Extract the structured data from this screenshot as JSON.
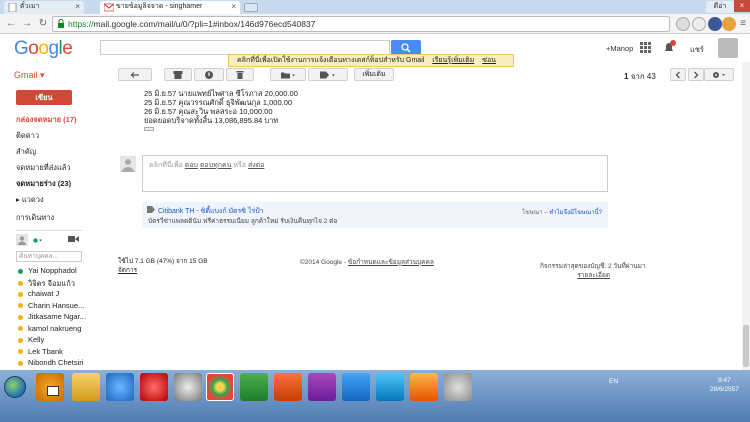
{
  "browser": {
    "tabs": [
      {
        "label": "ตั๋วเมา",
        "active": false
      },
      {
        "label": "ขายข้อมูลิจจาด - singhamer",
        "active": true
      }
    ],
    "user_badge": "ดีอ่า",
    "url_scheme": "https://",
    "url_rest": "mail.google.com/mail/u/0/?pli=1#inbox/146d976ecd540837"
  },
  "gmail": {
    "logo": "Google",
    "label": "Gmail ▾",
    "plus_user": "+Manop",
    "notifications_count": "1",
    "share_label": "แชร์",
    "banner_text": "คลิกที่นี่เพื่อเปิดใช้งานการแจ้งเตือนทางเดสก์ท็อปสำหรับ Gmail",
    "banner_link1": "เรียนรู้เพิ่มเติม",
    "banner_link2": "ซ่อน",
    "more_label": "เพิ่มเติม",
    "pager_prefix": "1",
    "pager_suffix": "จาก 43"
  },
  "sidebar": {
    "compose": "เขียน",
    "items": [
      {
        "label": "กล่องจดหมาย (17)",
        "style": "active"
      },
      {
        "label": "ติดดาว",
        "style": ""
      },
      {
        "label": "สำคัญ",
        "style": ""
      },
      {
        "label": "จดหมายที่ส่งแล้ว",
        "style": ""
      },
      {
        "label": "จดหมายร่าง (23)",
        "style": "bold"
      },
      {
        "label": "▸ แวดวง",
        "style": ""
      },
      {
        "label": "การเดินทาง",
        "style": ""
      }
    ],
    "chat_search_placeholder": "ค้นหาบุคคล...",
    "contacts": [
      {
        "name": "Yai Nopphadol",
        "status": "#0f9d58"
      },
      {
        "name": "วิจิตร จีอมแก้ว",
        "status": "#f4b400"
      },
      {
        "name": "chaiwat J",
        "status": "#f4b400"
      },
      {
        "name": "Charin Hansue...",
        "status": "#f4b400"
      },
      {
        "name": "Jitkasame Ngar...",
        "status": "#f4b400"
      },
      {
        "name": "kamol nakrueng",
        "status": "#f4b400"
      },
      {
        "name": "Kelly",
        "status": "#f4b400"
      },
      {
        "name": "Lek Tbank",
        "status": "#f4b400"
      },
      {
        "name": "Nibondh Chetsiri",
        "status": "#f4b400"
      },
      {
        "name": "warawat sajanaa",
        "status": "#f4b400"
      }
    ]
  },
  "message": {
    "donations": [
      "25 มิ.ย.57 นายแพทย์ไพศาล ซีโรภาส 20,000.00",
      "25 มิ.ย.57 คุณวรรณศักดิ์ ธุจิพัฒนกุล 1,000.00",
      "26 มิ.ย.57 คุณสะวิน พลสระอ 10,000.00",
      "ยอดยอดบริจาคทั้งสิ้น 13,086,895.84 บาท"
    ],
    "reply_prefix": "คลิกที่นี่เพื่อ",
    "reply_link1": "ตอบ",
    "reply_link2": "ตอบทุกคน",
    "reply_mid": "หรือ",
    "reply_link3": "ส่งต่อ"
  },
  "ad": {
    "title": "Citibank TH - ซิตี้แบงก์ บัตรซิ ไร่ป้า",
    "text": "บัตรวีซ่าแพลตตินัม ฟรีค่าธรรมเนียม ลูกค้าใหม่ รับเงินคืนทุกไจ 2 ต่อ",
    "right_label": "โฆษณา –",
    "right_link": "ทำไมจึงมีโฆษณานี้?"
  },
  "footer": {
    "storage": "ใช้ไป 7.1 GB (47%) จาก 15 GB",
    "manage": "จัดการ",
    "copyright": "©2014 Google -",
    "terms": "ข้อกำหนดและข้อมูลส่วนบุคคล",
    "activity": "กิจกรรมล่าสุดของบัญชี: 2 วันที่ผ่านมา",
    "details": "รายละเอียด"
  },
  "taskbar": {
    "lang": "EN",
    "time": "9:47",
    "date": "28/6/2557"
  }
}
